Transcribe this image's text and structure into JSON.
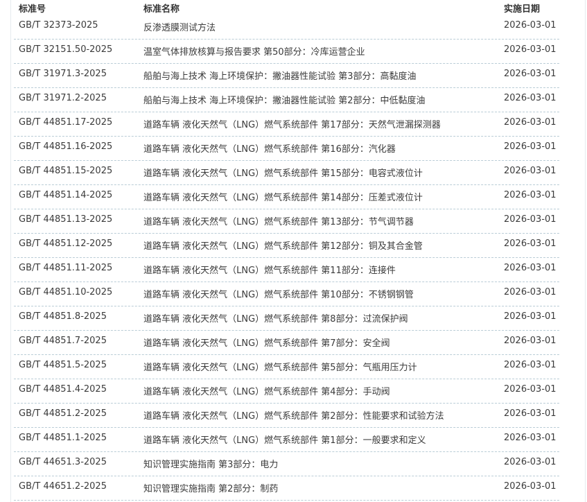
{
  "table": {
    "headers": {
      "code": "标准号",
      "name": "标准名称",
      "date": "实施日期"
    },
    "rows": [
      {
        "code": "GB/T 32373-2025",
        "name": "反渗透膜测试方法",
        "date": "2026-03-01"
      },
      {
        "code": "GB/T 32151.50-2025",
        "name": "温室气体排放核算与报告要求 第50部分：冷库运营企业",
        "date": "2026-03-01"
      },
      {
        "code": "GB/T 31971.3-2025",
        "name": "船舶与海上技术 海上环境保护：撇油器性能试验 第3部分：高黏度油",
        "date": "2026-03-01"
      },
      {
        "code": "GB/T 31971.2-2025",
        "name": "船舶与海上技术 海上环境保护：撇油器性能试验 第2部分：中低黏度油",
        "date": "2026-03-01"
      },
      {
        "code": "GB/T 44851.17-2025",
        "name": "道路车辆 液化天然气（LNG）燃气系统部件 第17部分：天然气泄漏探测器",
        "date": "2026-03-01"
      },
      {
        "code": "GB/T 44851.16-2025",
        "name": "道路车辆 液化天然气（LNG）燃气系统部件 第16部分：汽化器",
        "date": "2026-03-01"
      },
      {
        "code": "GB/T 44851.15-2025",
        "name": "道路车辆 液化天然气（LNG）燃气系统部件 第15部分：电容式液位计",
        "date": "2026-03-01"
      },
      {
        "code": "GB/T 44851.14-2025",
        "name": "道路车辆 液化天然气（LNG）燃气系统部件 第14部分：压差式液位计",
        "date": "2026-03-01"
      },
      {
        "code": "GB/T 44851.13-2025",
        "name": "道路车辆 液化天然气（LNG）燃气系统部件 第13部分：节气调节器",
        "date": "2026-03-01"
      },
      {
        "code": "GB/T 44851.12-2025",
        "name": "道路车辆 液化天然气（LNG）燃气系统部件 第12部分：铜及其合金管",
        "date": "2026-03-01"
      },
      {
        "code": "GB/T 44851.11-2025",
        "name": "道路车辆 液化天然气（LNG）燃气系统部件 第11部分：连接件",
        "date": "2026-03-01"
      },
      {
        "code": "GB/T 44851.10-2025",
        "name": "道路车辆 液化天然气（LNG）燃气系统部件 第10部分：不锈钢钢管",
        "date": "2026-03-01"
      },
      {
        "code": "GB/T 44851.8-2025",
        "name": "道路车辆 液化天然气（LNG）燃气系统部件 第8部分：过流保护阀",
        "date": "2026-03-01"
      },
      {
        "code": "GB/T 44851.7-2025",
        "name": "道路车辆 液化天然气（LNG）燃气系统部件 第7部分：安全阀",
        "date": "2026-03-01"
      },
      {
        "code": "GB/T 44851.5-2025",
        "name": "道路车辆 液化天然气（LNG）燃气系统部件 第5部分：气瓶用压力计",
        "date": "2026-03-01"
      },
      {
        "code": "GB/T 44851.4-2025",
        "name": "道路车辆 液化天然气（LNG）燃气系统部件 第4部分：手动阀",
        "date": "2026-03-01"
      },
      {
        "code": "GB/T 44851.2-2025",
        "name": "道路车辆 液化天然气（LNG）燃气系统部件 第2部分：性能要求和试验方法",
        "date": "2026-03-01"
      },
      {
        "code": "GB/T 44851.1-2025",
        "name": "道路车辆 液化天然气（LNG）燃气系统部件 第1部分：一般要求和定义",
        "date": "2026-03-01"
      },
      {
        "code": "GB/T 44651.3-2025",
        "name": "知识管理实施指南 第3部分：电力",
        "date": "2026-03-01"
      },
      {
        "code": "GB/T 44651.2-2025",
        "name": "知识管理实施指南 第2部分：制药",
        "date": "2026-03-01"
      }
    ]
  }
}
